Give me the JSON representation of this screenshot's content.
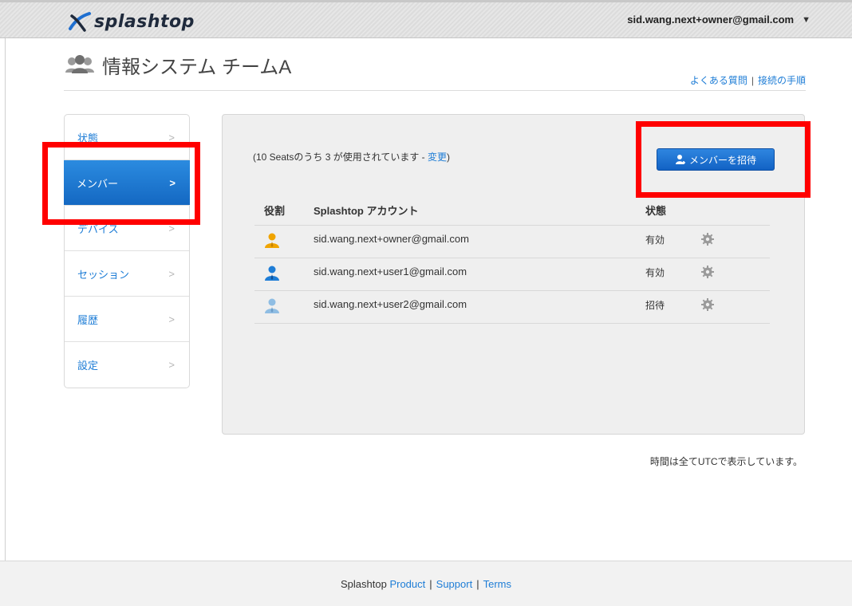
{
  "header": {
    "logo_text": "splashtop",
    "account_email": "sid.wang.next+owner@gmail.com",
    "caret": "▼"
  },
  "page": {
    "title": "情報システム チームA",
    "help_links": [
      "よくある質問",
      "接続の手順"
    ],
    "help_sep": "|"
  },
  "sidebar": {
    "items": [
      {
        "label": "状態",
        "active": false
      },
      {
        "label": "メンバー",
        "active": true
      },
      {
        "label": "デバイス",
        "active": false
      },
      {
        "label": "セッション",
        "active": false
      },
      {
        "label": "履歴",
        "active": false
      },
      {
        "label": "設定",
        "active": false
      }
    ],
    "chevron": ">"
  },
  "main": {
    "seats_prefix": "(10 Seatsのうち 3 が使用されています - ",
    "seats_link": "変更",
    "seats_suffix": ")",
    "invite_label": "メンバーを招待",
    "columns": [
      "役割",
      "Splashtop アカウント",
      "状態"
    ],
    "members": [
      {
        "role_icon": "owner-icon",
        "role_color": "#f0a400",
        "account": "sid.wang.next+owner@gmail.com",
        "status": "有効"
      },
      {
        "role_icon": "user-icon",
        "role_color": "#1e7dd6",
        "account": "sid.wang.next+user1@gmail.com",
        "status": "有効"
      },
      {
        "role_icon": "invited-user-icon",
        "role_color": "#8fbde3",
        "account": "sid.wang.next+user2@gmail.com",
        "status": "招待"
      }
    ],
    "utc_note": "時間は全てUTCで表示しています。"
  },
  "footer": {
    "brand": "Splashtop",
    "links": [
      "Product",
      "Support",
      "Terms"
    ],
    "sep": "|"
  },
  "colors": {
    "accent": "#1e7dd6",
    "highlight": "#ff0000",
    "panel_bg": "#efefef"
  }
}
